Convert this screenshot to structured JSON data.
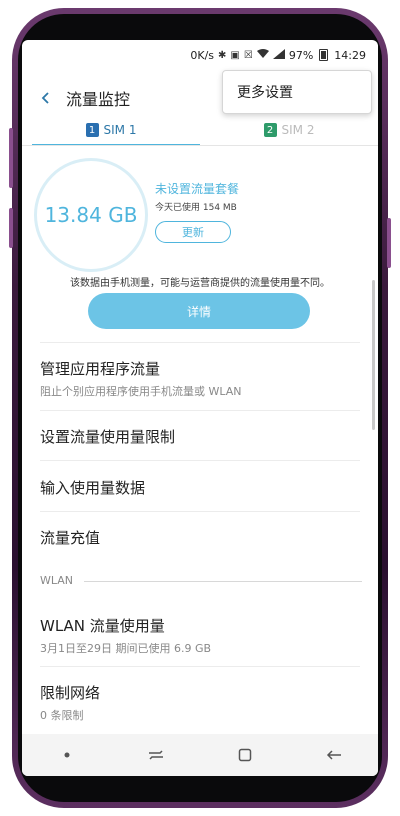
{
  "status_bar": {
    "speed": "0K/s",
    "battery": "97%",
    "time": "14:29",
    "icons": [
      "bluetooth-icon",
      "nfc-icon",
      "mute-icon",
      "wifi-icon",
      "signal-icon",
      "battery-icon"
    ]
  },
  "header": {
    "title": "流量监控",
    "menu_item": "更多设置"
  },
  "tabs": [
    {
      "badge": "1",
      "label": "SIM 1",
      "selected": true
    },
    {
      "badge": "2",
      "label": "SIM 2",
      "selected": false
    }
  ],
  "usage": {
    "total": "13.84 GB",
    "plan_status": "未设置流量套餐",
    "today": "今天已使用 154 MB",
    "update_label": "更新",
    "disclaimer": "该数据由手机测量，可能与运营商提供的流量使用量不同。",
    "details_label": "详情"
  },
  "list": {
    "manage_title": "管理应用程序流量",
    "manage_sub": "阻止个别应用程序使用手机流量或 WLAN",
    "limit_title": "设置流量使用量限制",
    "input_title": "输入使用量数据",
    "recharge_title": "流量充值",
    "wlan_section": "WLAN",
    "wlan_usage_title": "WLAN 流量使用量",
    "wlan_usage_sub": "3月1日至29日 期间已使用 6.9 GB",
    "restrict_title": "限制网络",
    "restrict_sub": "0 条限制"
  },
  "colors": {
    "accent": "#4fb5dd",
    "details_button": "#6cc4e6",
    "sim1": "#2a6fb0",
    "sim2": "#2e9b6a",
    "phone_frame": "#5c2f60"
  }
}
